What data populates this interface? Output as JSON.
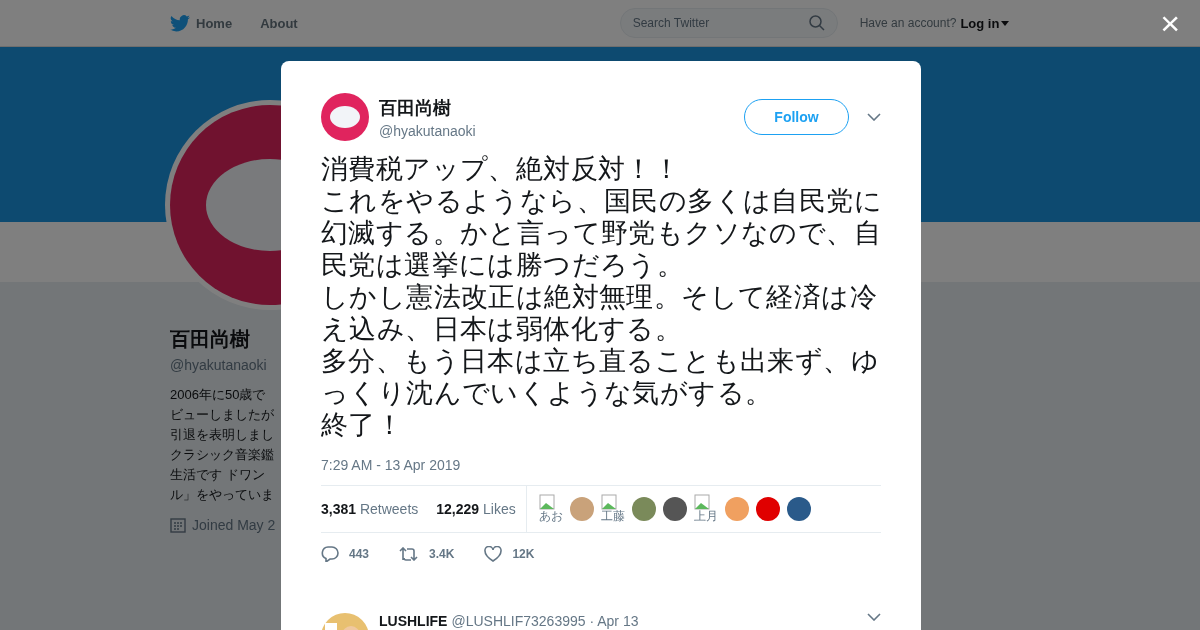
{
  "nav": {
    "items": [
      {
        "label": "Home"
      },
      {
        "label": "About"
      }
    ],
    "search": {
      "placeholder": "Search Twitter"
    },
    "account_prompt": "Have an account?",
    "login": "Log in"
  },
  "profile": {
    "name": "百田尚樹",
    "handle": "@hyakutanaoki",
    "bio_lines": [
      "2006年に50歳で",
      "ビューしましたが",
      "引退を表明しまし",
      "クラシック音楽鑑",
      "生活です ドワン",
      "ル」をやっていま"
    ],
    "joined": "Joined May 2"
  },
  "modal": {
    "close": "×",
    "author": {
      "name": "百田尚樹",
      "handle": "@hyakutanaoki"
    },
    "follow": "Follow",
    "paragraphs": [
      "消費税アップ、絶対反対！！",
      "これをやるようなら、国民の多くは自民党に幻滅する。かと言って野党もクソなので、自民党は選挙には勝つだろう。",
      "しかし憲法改正は絶対無理。そして経済は冷え込み、日本は弱体化する。",
      "多分、もう日本は立ち直ることも出来ず、ゆっくり沈んでいくような気がする。",
      "終了！"
    ],
    "time": "7:29 AM - 13 Apr 2019",
    "stats": [
      {
        "count": "3,381",
        "label": "Retweets"
      },
      {
        "count": "12,229",
        "label": "Likes"
      }
    ],
    "likers": [
      {
        "kind": "broken",
        "alt": "あお"
      },
      {
        "kind": "avatar",
        "color": "#c9a27a"
      },
      {
        "kind": "broken",
        "alt": "工藤"
      },
      {
        "kind": "avatar",
        "color": "#7a8a5a"
      },
      {
        "kind": "avatar",
        "color": "#555555"
      },
      {
        "kind": "broken",
        "alt": "上月"
      },
      {
        "kind": "avatar",
        "color": "#f0a060"
      },
      {
        "kind": "avatar",
        "color": "#e00000"
      },
      {
        "kind": "avatar",
        "color": "#2a5a8a"
      }
    ],
    "actions": [
      {
        "kind": "reply",
        "count": "443"
      },
      {
        "kind": "retweet",
        "count": "3.4K"
      },
      {
        "kind": "like",
        "count": "12K"
      }
    ],
    "reply": {
      "name": "LUSHLIFE",
      "handle": "@LUSHLIF73263995",
      "date": "· Apr 13"
    }
  }
}
